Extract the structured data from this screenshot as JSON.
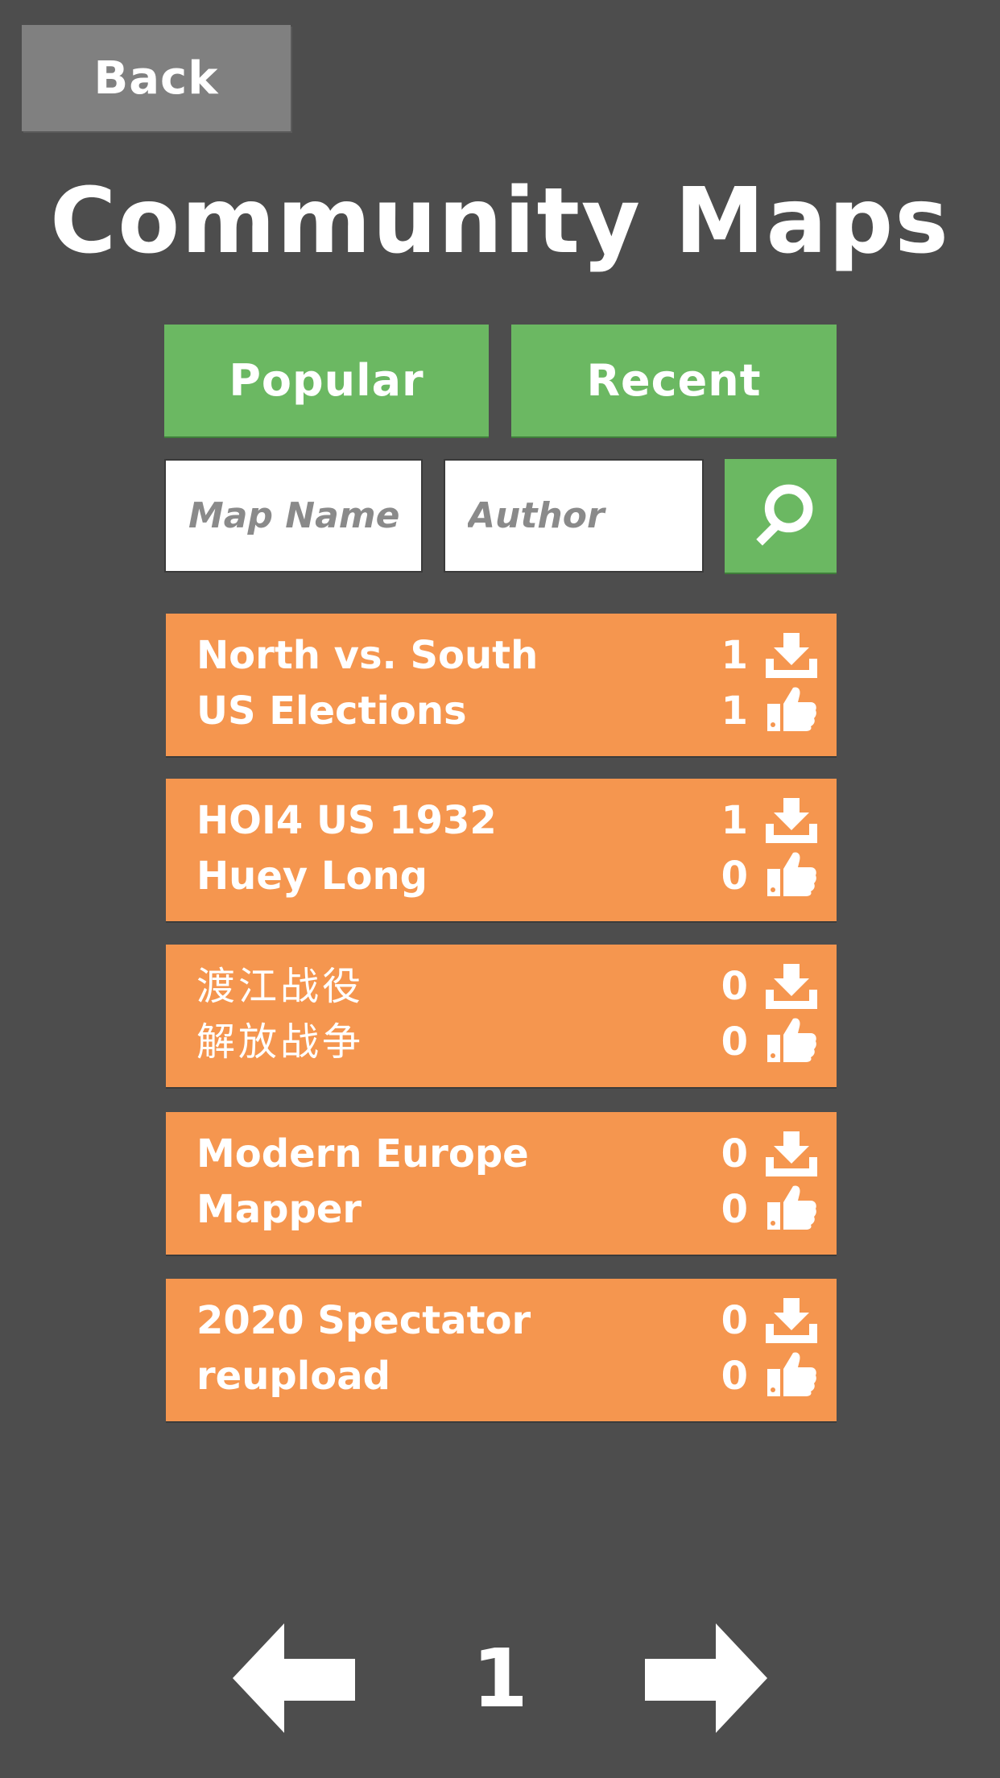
{
  "header": {
    "back_label": "Back",
    "title": "Community Maps"
  },
  "sort": {
    "popular_label": "Popular",
    "recent_label": "Recent"
  },
  "search": {
    "map_name_placeholder": "Map Name",
    "map_name_value": "",
    "author_placeholder": "Author",
    "author_value": "",
    "button_icon": "search-icon"
  },
  "maps": [
    {
      "name": "North vs. South",
      "author": "US Elections",
      "downloads": "1",
      "likes": "1"
    },
    {
      "name": "HOI4 US 1932",
      "author": "Huey Long",
      "downloads": "1",
      "likes": "0"
    },
    {
      "name": "渡江战役",
      "author": "解放战争",
      "downloads": "0",
      "likes": "0"
    },
    {
      "name": "Modern Europe",
      "author": "Mapper",
      "downloads": "0",
      "likes": "0"
    },
    {
      "name": "2020 Spectator",
      "author": "reupload",
      "downloads": "0",
      "likes": "0"
    }
  ],
  "icons": {
    "downloads": "download-icon",
    "likes": "thumbs-up-icon",
    "prev": "arrow-left-icon",
    "next": "arrow-right-icon"
  },
  "pagination": {
    "current_page": "1"
  },
  "colors": {
    "background": "#4d4d4d",
    "back_button": "#808080",
    "accent_green": "#6bb862",
    "row_orange": "#f5964f",
    "text": "#ffffff"
  }
}
